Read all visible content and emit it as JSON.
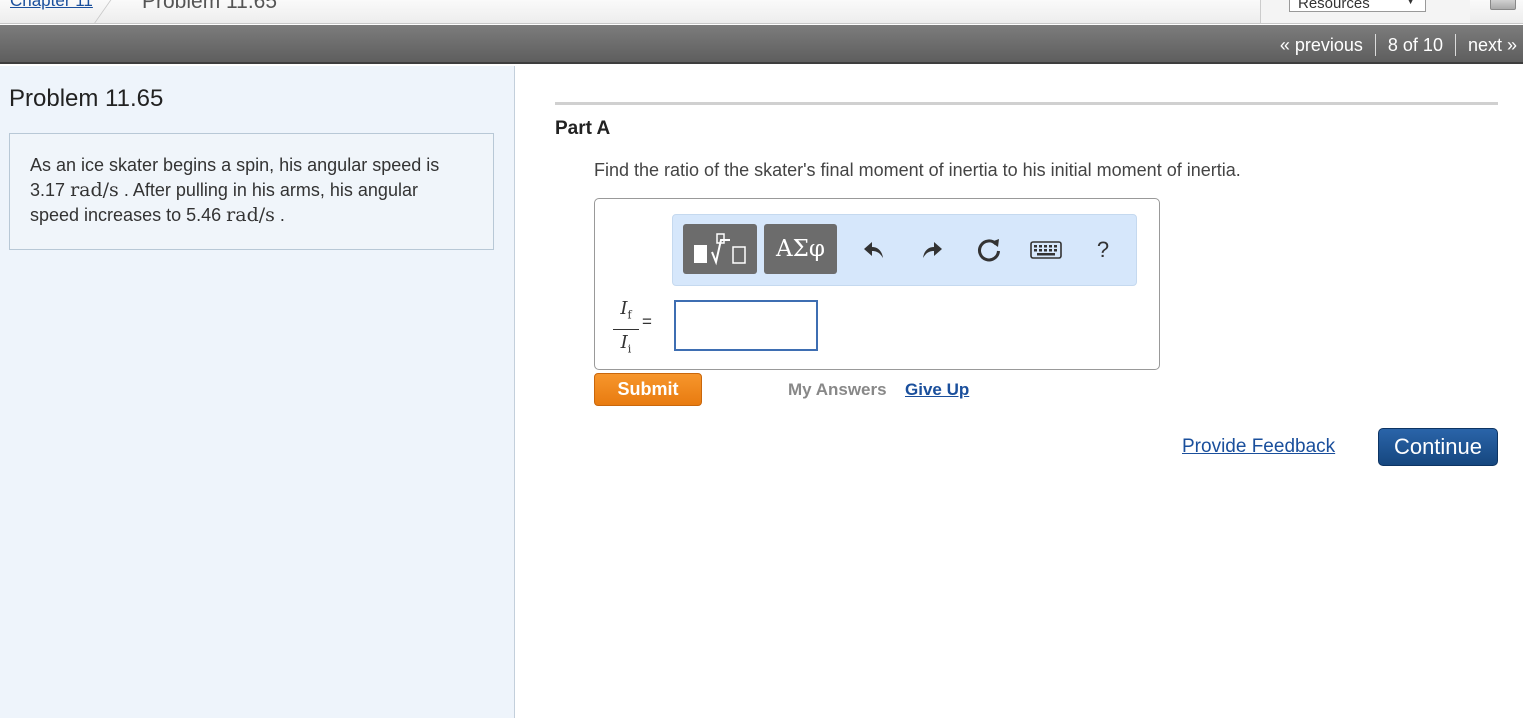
{
  "breadcrumb": {
    "chapter_link": "Chapter 11",
    "current": "Problem 11.65"
  },
  "resources": {
    "selected": "Resources"
  },
  "nav": {
    "previous": "« previous",
    "position": "8 of 10",
    "next": "next »"
  },
  "problem": {
    "title": "Problem 11.65",
    "statement_1": "As an ice skater begins a spin, his angular speed is",
    "speed_initial": "3.17",
    "unit": "rad/s",
    "statement_2": ". After pulling in his arms, his angular",
    "statement_3": "speed increases to",
    "speed_final": "5.46",
    "statement_4": "."
  },
  "part": {
    "label": "Part A",
    "question": "Find the ratio of the skater's final moment of inertia to his initial moment of inertia."
  },
  "toolbar": {
    "greek_label": "ΑΣφ",
    "help_label": "?",
    "icons": [
      "templates-icon",
      "greek-letters-icon",
      "undo-icon",
      "redo-icon",
      "reset-icon",
      "keyboard-icon",
      "help-icon"
    ]
  },
  "answer": {
    "numerator": "I",
    "numerator_sub": "f",
    "denominator": "I",
    "denominator_sub": "i",
    "equals": "=",
    "value": ""
  },
  "actions": {
    "submit": "Submit",
    "my_answers": "My Answers",
    "give_up": "Give Up",
    "provide_feedback": "Provide Feedback",
    "continue": "Continue"
  },
  "colors": {
    "submit": "#f08a1e",
    "continue": "#1f5596",
    "link": "#1a4f9c",
    "left_panel": "#eef4fb",
    "toolbar": "#d6e7fb"
  }
}
